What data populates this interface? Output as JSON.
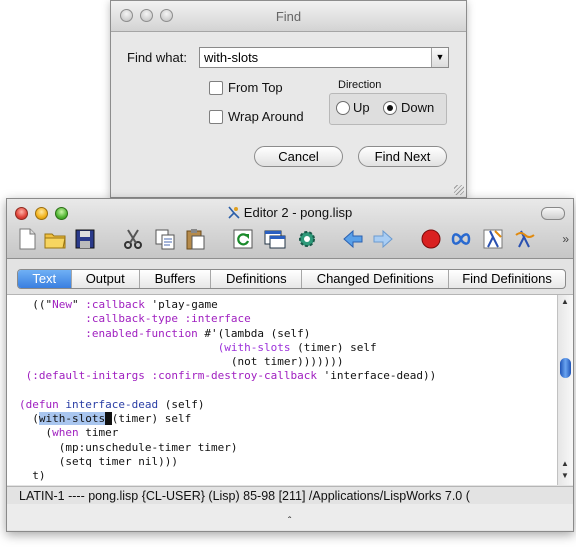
{
  "find_dialog": {
    "title": "Find",
    "find_what_label": "Find what:",
    "find_what_value": "with-slots",
    "from_top_label": "From Top",
    "from_top_checked": false,
    "wrap_around_label": "Wrap Around",
    "wrap_around_checked": false,
    "direction_label": "Direction",
    "direction_up_label": "Up",
    "direction_down_label": "Down",
    "direction_selected": "Down",
    "cancel_label": "Cancel",
    "find_next_label": "Find Next"
  },
  "editor": {
    "title": "Editor 2 - pong.lisp",
    "toolbar_icons": [
      "new-file-icon",
      "open-folder-icon",
      "save-icon",
      "cut-icon",
      "copy-icon",
      "paste-icon",
      "refresh-icon",
      "windows-icon",
      "gear-icon",
      "back-arrow-icon",
      "forward-arrow-icon",
      "stop-icon",
      "infinity-icon",
      "lambda-icon",
      "wave-lambda-icon"
    ],
    "tabs": [
      "Text",
      "Output",
      "Buffers",
      "Definitions",
      "Changed Definitions",
      "Find Definitions"
    ],
    "active_tab": "Text",
    "code_lines": {
      "l1a": "((\"",
      "l1b": "New",
      "l1c": "\" ",
      "l1d": ":callback",
      "l1e": " 'play-game",
      "l2": "          :callback-type :interface",
      "l3a": "          :enabled-function",
      "l3b": " #'(lambda (self)",
      "l4a": "                              ",
      "l4b": "(with-slots",
      "l4c": " (timer) self",
      "l5": "                                (not timer)))))))",
      "l6a": " ",
      "l6b": "(:default-initargs :confirm-destroy-callback",
      "l6c": " 'interface-dead))",
      "l7": "",
      "l8a": "(defun ",
      "l8b": "interface-dead",
      "l8c": " (self)",
      "l9a": "  (",
      "l9b": "with-slots",
      "l9c": " ",
      "l9d": "(timer) self",
      "l10a": "    (",
      "l10b": "when",
      "l10c": " timer",
      "l11": "      (mp:unschedule-timer timer)",
      "l12": "      (setq timer nil)))",
      "l13": "  t)"
    },
    "status_line": "LATIN-1 ---- pong.lisp     {CL-USER} (Lisp) 85-98 [211] /Applications/LispWorks 7.0 (",
    "echo_area": "ˆ"
  },
  "colors": {
    "keyword": "#a020c0",
    "function_name": "#2a3ea5",
    "selection": "#a9c6ef",
    "tab_active": "#3a7fe0"
  }
}
